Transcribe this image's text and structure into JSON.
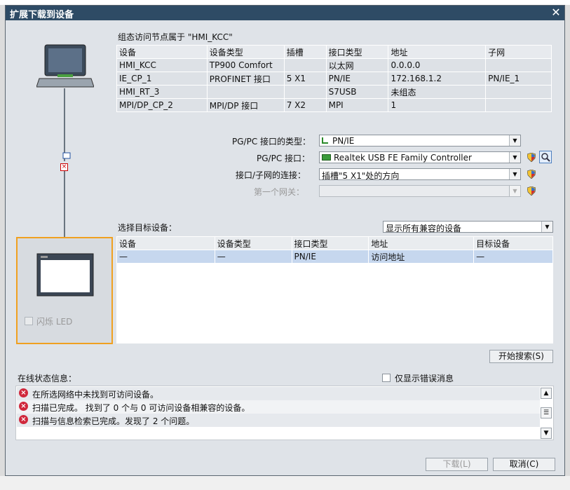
{
  "window": {
    "title": "扩展下载到设备",
    "close_glyph": "✕"
  },
  "config_section": {
    "heading": "组态访问节点属于 \"HMI_KCC\"",
    "columns": [
      "设备",
      "设备类型",
      "插槽",
      "接口类型",
      "地址",
      "子网"
    ],
    "rows": [
      [
        "HMI_KCC",
        "TP900 Comfort",
        "",
        "以太网",
        "0.0.0.0",
        ""
      ],
      [
        "IE_CP_1",
        "PROFINET 接口",
        "5 X1",
        "PN/IE",
        "172.168.1.2",
        "PN/IE_1"
      ],
      [
        "HMI_RT_3",
        "",
        "",
        "S7USB",
        "未组态",
        ""
      ],
      [
        "MPI/DP_CP_2",
        "MPI/DP 接口",
        "7 X2",
        "MPI",
        "1",
        ""
      ]
    ]
  },
  "pgpc": {
    "type_label": "PG/PC 接口的类型：",
    "type_value": "PN/IE",
    "iface_label": "PG/PC 接口：",
    "iface_value": "Realtek USB FE Family Controller",
    "conn_label": "接口/子网的连接：",
    "conn_value": "插槽\"5 X1\"处的方向",
    "gateway_label": "第一个网关：",
    "gateway_value": ""
  },
  "target_section": {
    "label": "选择目标设备：",
    "filter_value": "显示所有兼容的设备",
    "columns": [
      "设备",
      "设备类型",
      "接口类型",
      "地址",
      "目标设备"
    ],
    "rows": [
      [
        "—",
        "—",
        "PN/IE",
        "访问地址",
        "—"
      ]
    ]
  },
  "flash_led_label": "闪烁 LED",
  "search_button": "开始搜索(S)",
  "status": {
    "label": "在线状态信息：",
    "errors_only_label": "仅显示错误消息",
    "messages": [
      "在所选网络中未找到可访问设备。",
      "扫描已完成。 找到了 0 个与 0 可访问设备相兼容的设备。",
      "扫描与信息检索已完成。发现了 2 个问题。"
    ]
  },
  "buttons": {
    "download": "下载(L)",
    "cancel": "取消(C)"
  },
  "colors": {
    "title_bar": "#2e4b65",
    "selection_frame": "#f0a020",
    "error": "#d0283c",
    "link_line": "#6a7580"
  }
}
